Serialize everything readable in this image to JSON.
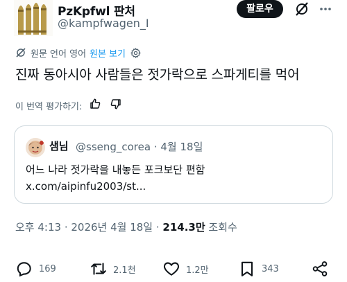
{
  "author": {
    "name": "PzKpfwl 판처",
    "handle": "@kampfwagen_I",
    "avatar_icon": "ammunition-shells-icon"
  },
  "follow_label": "팔로우",
  "header_icons": [
    "grok-icon",
    "more-icon"
  ],
  "translate": {
    "original_language": "원문 언어 영어",
    "show_original": "원본 보기"
  },
  "tweet_text": "진짜 동아시아 사람들은 젓가락으로 스파게티를 먹어",
  "rate_translation": "이 번역 평가하기:",
  "quote": {
    "name": "샘님",
    "handle_date": "@sseng_corea · 4월 18일",
    "text": "어느 나라 젓가락을 내놓든 포크보단 편함",
    "link": "x.com/aipinfu2003/st..."
  },
  "meta": {
    "time_date": "오후 4:13 · 2026년 4월 18일 · ",
    "views_count": "214.3만",
    "views_label": " 조회수"
  },
  "actions": {
    "replies": "169",
    "reposts": "2.1천",
    "likes": "1.2만",
    "bookmarks": "343"
  },
  "colors": {
    "text": "#0f1419",
    "secondary": "#536471",
    "link": "#1d9bf0",
    "border": "#cfd9de"
  }
}
